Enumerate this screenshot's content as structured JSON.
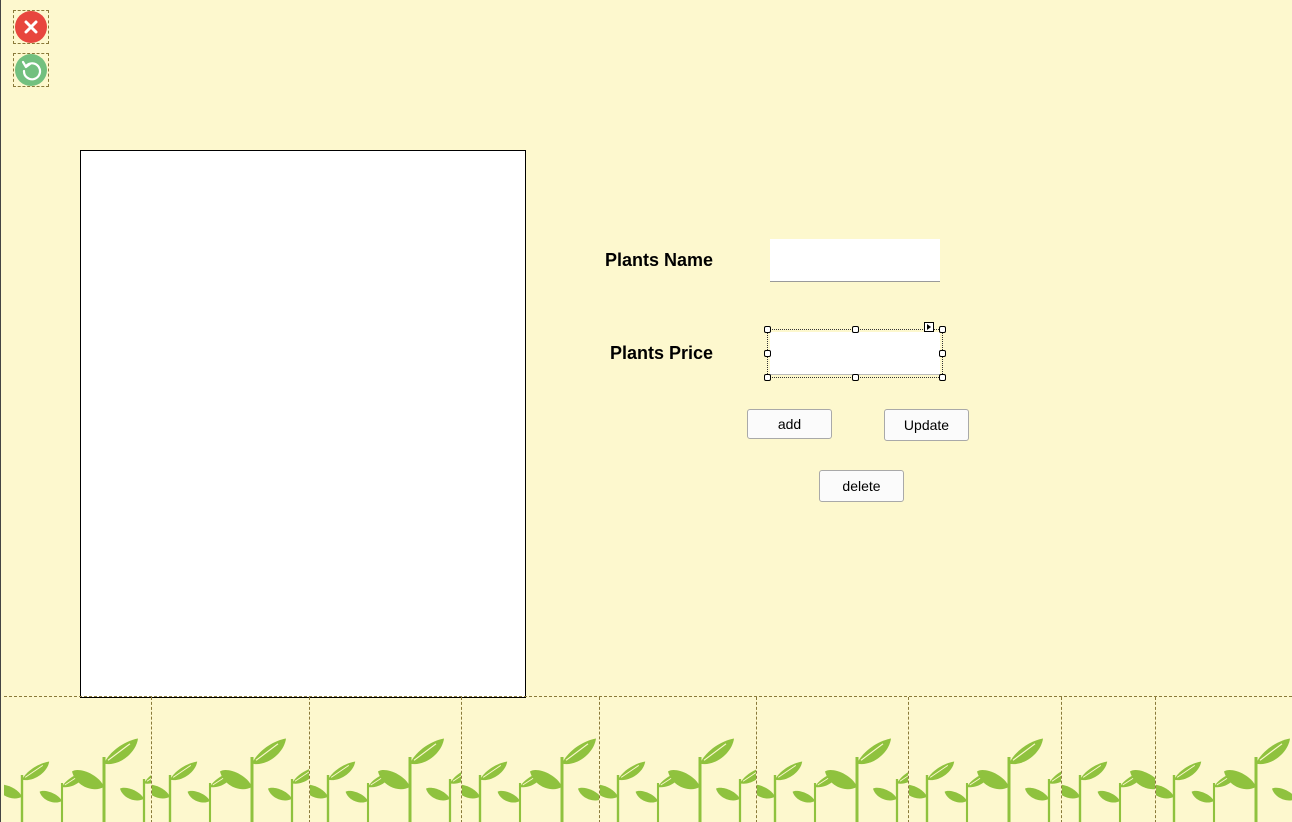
{
  "window": {
    "close_icon": "close-icon",
    "refresh_icon": "refresh-icon"
  },
  "form": {
    "name_label": "Plants Name",
    "name_value": "",
    "price_label": "Plants Price",
    "price_value": ""
  },
  "actions": {
    "add_label": "add",
    "update_label": "Update",
    "delete_label": "delete"
  },
  "footer": {
    "decoration": "sprout-pattern",
    "tile_count": 9
  },
  "colors": {
    "background": "#fdf8ce",
    "close_red": "#e8463e",
    "refresh_green": "#72c07f",
    "sprout_green": "#8fc23e"
  }
}
